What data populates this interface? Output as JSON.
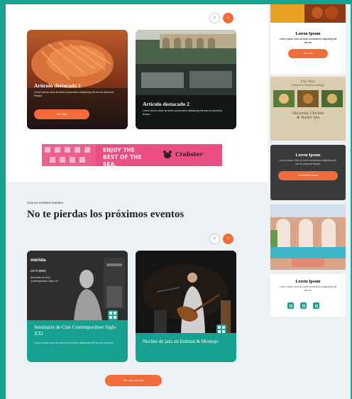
{
  "slider": {
    "prev": "‹",
    "next": "›"
  },
  "featured": [
    {
      "title": "Artículo destacado 1",
      "text": "Lorem ipsum dolor sit amet consectetur adipiscing elit sed do eiusmod tempor",
      "button": "Ver más"
    },
    {
      "title": "Artículo destacado 2",
      "text": "Lorem ipsum dolor sit amet consectetur adipiscing elit sed do eiusmod tempor"
    }
  ],
  "banner": {
    "slogan": "ENJOY THE BEST OF THE SEA.",
    "brand": "Crabster"
  },
  "events": {
    "eyebrow": "Conoce nuestros eventos",
    "title": "No te pierdas los próximos eventos",
    "items": [
      {
        "title": "Seminario de Cine Contemporáneo Siglo XXI",
        "text": "Lorem ipsum dolor sit amet consectetur adipiscing elit sed do eiusmod",
        "poster": {
          "city": "mérida",
          "month": "OCTUBRE",
          "name": "Seminario de Cine Contemporáneo Siglo XXI"
        }
      },
      {
        "title": "Noches de jazz en Itzimná & Montejo",
        "text": ""
      }
    ],
    "more_button": "Ver más eventos"
  },
  "sidebar": {
    "promo1": {
      "title": "Lorem Ipsum",
      "text": "Lorem ipsum dolor sit amet consectetur adipiscing elit sed do.",
      "button": "Ver más"
    },
    "ad_card": {
      "line1": "Day Pass",
      "line2": "Included in Hacienda Package",
      "line3": "Hacienda Chichen",
      "line4": "& Yaxkin Spa"
    },
    "promo2": {
      "title": "Lorem Ipsum",
      "text": "Lorem ipsum dolor sit amet consectetur adipiscing elit sed do eiusmod tempor.",
      "button": "Suscríbete ahora"
    },
    "promo3": {
      "title": "Lorem Ipsum",
      "text": "Lorem ipsum dolor sit amet consectetur adipiscing elit sed do."
    }
  },
  "colors": {
    "accent": "#f26b3a",
    "teal": "#14a48f",
    "dark": "#3a3a3a"
  }
}
